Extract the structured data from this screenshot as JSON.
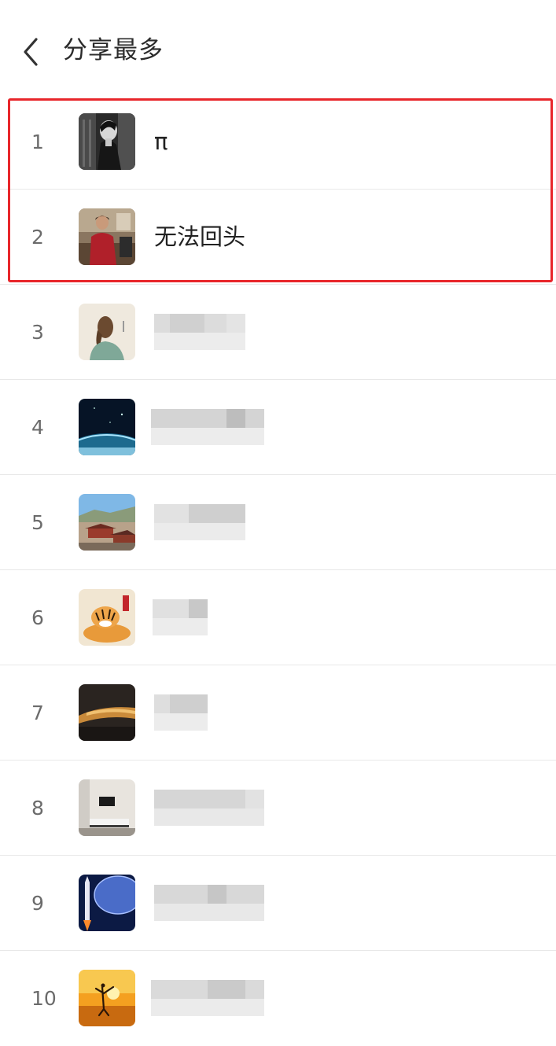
{
  "header": {
    "title": "分享最多"
  },
  "list": [
    {
      "rank": "1",
      "name": "π",
      "avatar": "portrait-bw-avatar"
    },
    {
      "rank": "2",
      "name": "无法回头",
      "avatar": "person-red-dress-avatar"
    },
    {
      "rank": "3",
      "name": "",
      "avatar": "girl-illustration-avatar"
    },
    {
      "rank": "4",
      "name": "",
      "avatar": "planet-space-avatar"
    },
    {
      "rank": "5",
      "name": "",
      "avatar": "temple-landscape-avatar"
    },
    {
      "rank": "6",
      "name": "",
      "avatar": "tiger-cartoon-avatar"
    },
    {
      "rank": "7",
      "name": "",
      "avatar": "sunset-clouds-avatar"
    },
    {
      "rank": "8",
      "name": "",
      "avatar": "living-room-avatar"
    },
    {
      "rank": "9",
      "name": "",
      "avatar": "rocket-planet-avatar"
    },
    {
      "rank": "10",
      "name": "",
      "avatar": "sunset-dancer-avatar"
    }
  ],
  "highlight_color": "#e8262b"
}
